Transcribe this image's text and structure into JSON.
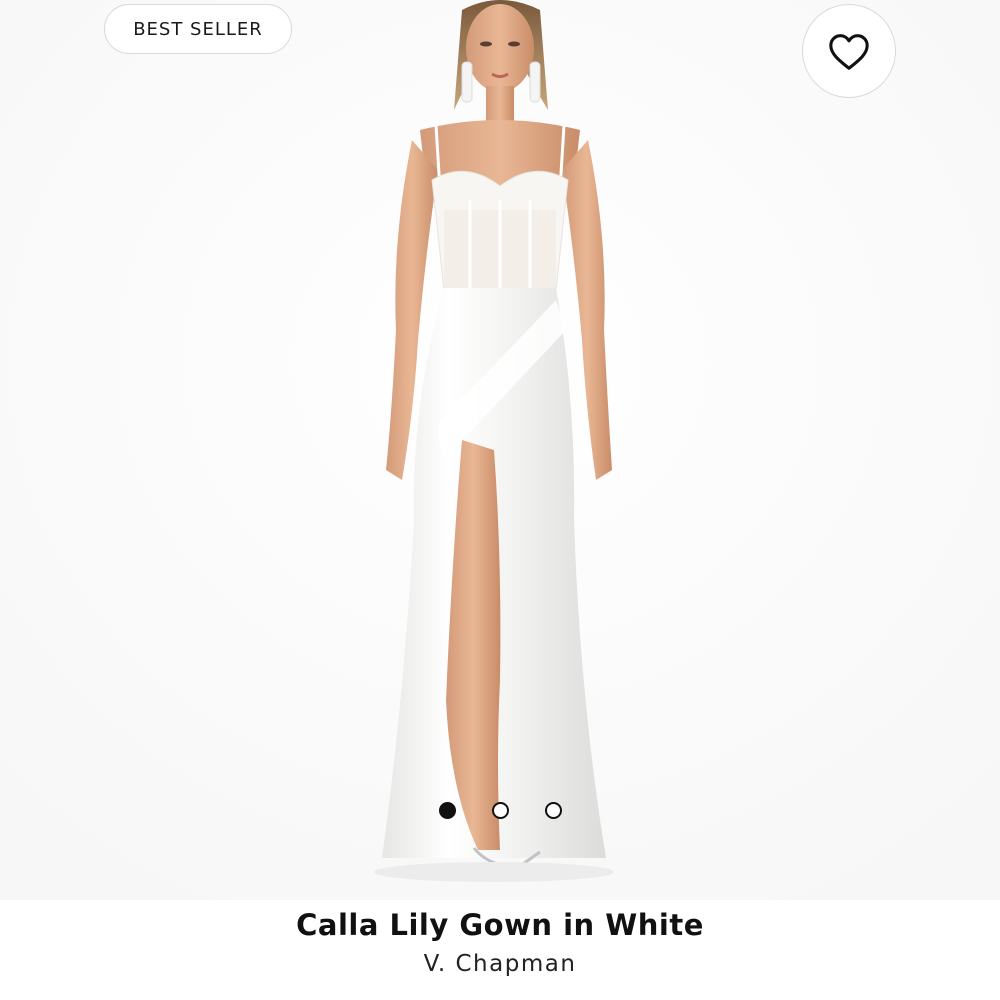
{
  "product": {
    "badge": "BEST SELLER",
    "title": "Calla Lily Gown in White",
    "brand": "V. Chapman",
    "image_alt": "Model wearing a white satin gown with lace corset bodice and front slit"
  },
  "carousel": {
    "total": 3,
    "active_index": 0
  },
  "icons": {
    "favorite": "heart-outline-icon"
  },
  "colors": {
    "text": "#111111",
    "dot_active": "#111111",
    "border": "#d8d8d8"
  }
}
